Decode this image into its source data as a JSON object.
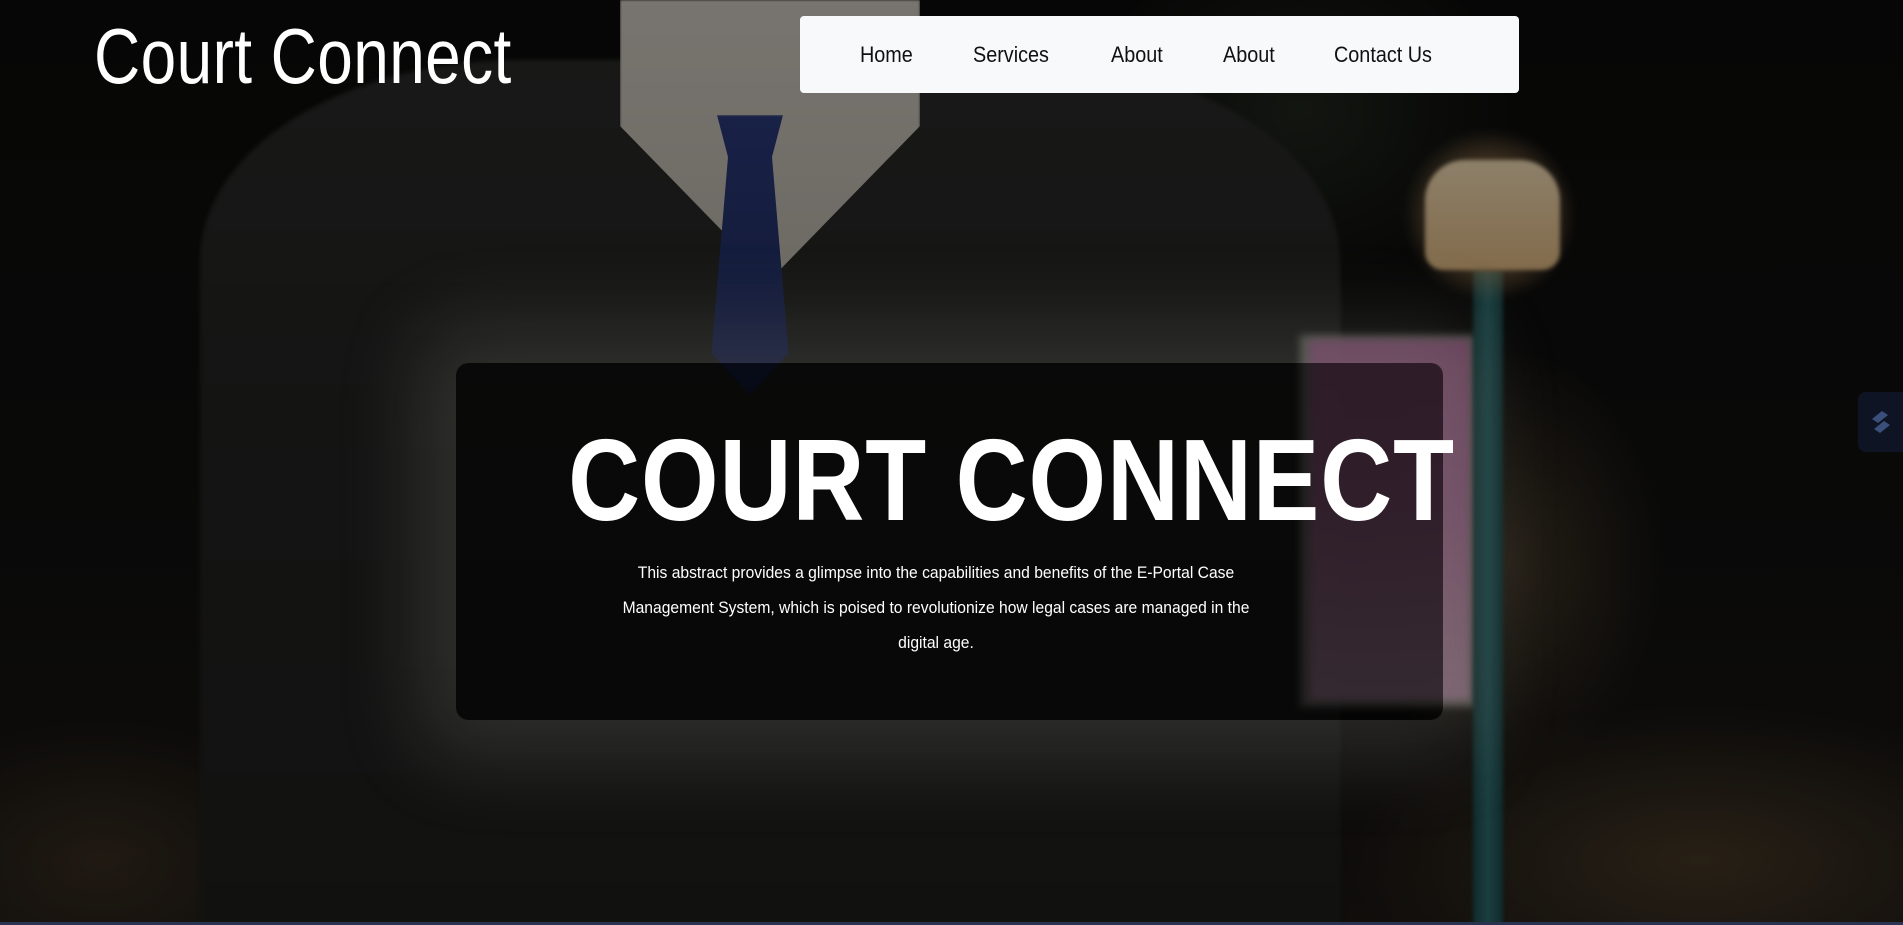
{
  "header": {
    "logo_text": "Court Connect"
  },
  "nav": {
    "items": [
      {
        "label": "Home"
      },
      {
        "label": "Services"
      },
      {
        "label": "About"
      },
      {
        "label": "About"
      },
      {
        "label": "Contact Us"
      }
    ]
  },
  "hero": {
    "title": "COURT CONNECT",
    "description": "This abstract provides a glimpse into the capabilities and benefits of the E-Portal Case Management System, which is poised to revolutionize how legal cases are managed in the digital age."
  },
  "side_widget": {
    "icon": "extension-icon"
  },
  "colors": {
    "nav_background": "#f8f9fa",
    "text_light": "#ffffff",
    "tie_blue": "#2b3a7a",
    "lamp_pole_teal": "#2f6d70"
  }
}
